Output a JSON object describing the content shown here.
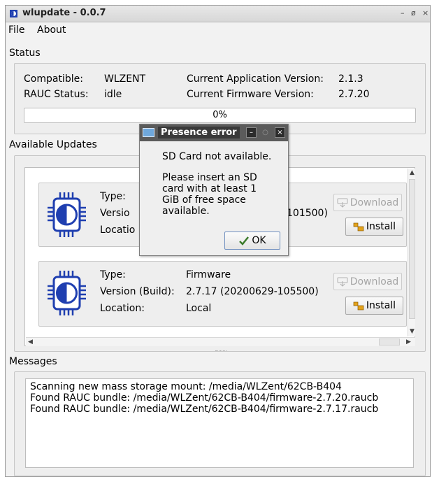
{
  "window": {
    "title": "wlupdate - 0.0.7",
    "controls": [
      "–",
      "ø",
      "×"
    ]
  },
  "menu": [
    "File",
    "About"
  ],
  "status": {
    "section_title": "Status",
    "compatible_label": "Compatible:",
    "compatible_value": "WLZENT",
    "rauc_label": "RAUC Status:",
    "rauc_value": "idle",
    "app_version_label": "Current Application Version:",
    "app_version_value": "2.1.3",
    "fw_version_label": "Current Firmware Version:",
    "fw_version_value": "2.7.20",
    "progress_text": "0%",
    "progress_fraction": 0
  },
  "updates": {
    "section_title": "Available Updates",
    "type_label": "Type:",
    "version_label": "Version (Build):",
    "location_label": "Location:",
    "download_label": "Download",
    "install_label": "Install",
    "items": [
      {
        "type": "",
        "version": "101500)",
        "location": "",
        "version_label_visible": "Versio",
        "location_label_visible": "Locatio"
      },
      {
        "type": "Firmware",
        "version": "2.7.17 (20200629-105500)",
        "location": "Local"
      }
    ]
  },
  "messages": {
    "section_title": "Messages",
    "lines": [
      "Scanning new mass storage mount: /media/WLZent/62CB-B404",
      "Found RAUC bundle: /media/WLZent/62CB-B404/firmware-2.7.20.raucb",
      "Found RAUC bundle: /media/WLZent/62CB-B404/firmware-2.7.17.raucb"
    ]
  },
  "dialog": {
    "title": "Presence error",
    "message": "SD Card not available.",
    "detail_lines": [
      "Please insert an SD",
      "card with at least 1",
      "GiB of free space",
      "available."
    ],
    "ok_label": "OK",
    "controls": [
      "–",
      "○",
      "×"
    ]
  },
  "colors": {
    "chip_blue": "#1f3fb0",
    "titlebar": "#d9d9d9",
    "dialog_title": "#3a3a3a"
  }
}
